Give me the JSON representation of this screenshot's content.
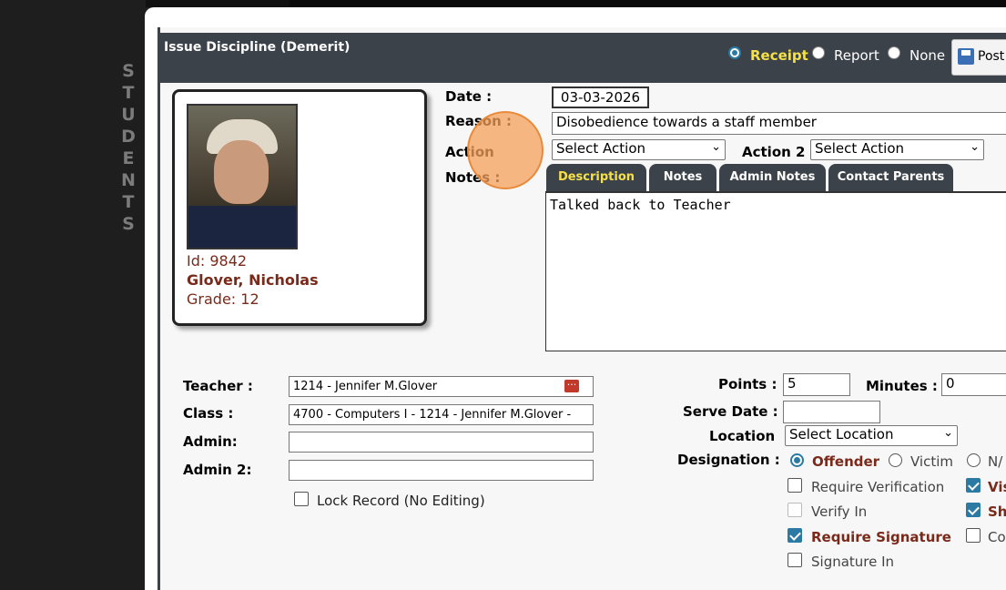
{
  "sidebar": {
    "vertical_label": [
      "S",
      "T",
      "U",
      "D",
      "E",
      "N",
      "T",
      "S"
    ]
  },
  "header": {
    "title": "Issue Discipline (Demerit)",
    "print_options": [
      {
        "label": "Receipt",
        "checked": true
      },
      {
        "label": "Report",
        "checked": false
      },
      {
        "label": "None",
        "checked": false
      }
    ],
    "post_label": "Post"
  },
  "student": {
    "id_line": "Id: 9842",
    "name": "Glover, Nicholas",
    "grade_line": "Grade: 12"
  },
  "form": {
    "date_label": "Date :",
    "date_value": "03-03-2026",
    "reason_label": "Reason :",
    "reason_value": "Disobedience towards a staff member",
    "action_label": "Action",
    "action_value": "Select Action",
    "action2_label": "Action 2",
    "action2_value": "Select Action",
    "notes_label": "Notes :",
    "tabs": [
      "Description",
      "Notes",
      "Admin Notes",
      "Contact Parents"
    ],
    "active_tab": "Description",
    "notes_text": "Talked back to Teacher",
    "teacher_label": "Teacher :",
    "teacher_value": "1214 - Jennifer M.Glover",
    "class_label": "Class :",
    "class_value": "4700 - Computers I - 1214 - Jennifer M.Glover -",
    "admin_label": "Admin:",
    "admin_value": "",
    "admin2_label": "Admin 2:",
    "admin2_value": "",
    "lock_label": "Lock Record (No Editing)",
    "points_label": "Points :",
    "points_value": "5",
    "minutes_label": "Minutes :",
    "minutes_value": "0",
    "serve_date_label": "Serve Date :",
    "serve_date_value": "",
    "location_label": "Location",
    "location_value": "Select Location",
    "designation_label": "Designation :",
    "designation_options": [
      "Offender",
      "Victim",
      "N/"
    ],
    "checks": {
      "require_verification": "Require Verification",
      "verify_in": "Verify In",
      "require_signature": "Require Signature",
      "signature_in": "Signature In",
      "vis": "Vis",
      "sh": "Sh",
      "co": "Co"
    }
  },
  "colors": {
    "header_bg": "#3b4249",
    "accent_yellow": "#f5e04a",
    "student_text": "#7a2a1a",
    "check_blue": "#2a7aa3"
  }
}
